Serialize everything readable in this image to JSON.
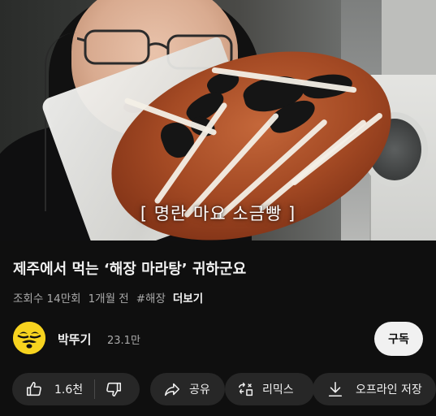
{
  "video": {
    "caption": "[ 명란 마요 소금빵 ]"
  },
  "info": {
    "title": "제주에서 먹는 ‘해장 마라탕’ 귀하군요",
    "views": "조회수 14만회",
    "age": "1개월 전",
    "hashtag": "#해장",
    "more_label": "더보기"
  },
  "channel": {
    "name": "박뚜기",
    "subscribers": "23.1만",
    "subscribe_label": "구독",
    "avatar_color": "#f7d31f"
  },
  "actions": {
    "like_count": "1.6천",
    "share_label": "공유",
    "remix_label": "리믹스",
    "download_label": "오프라인 저장"
  },
  "icons": {
    "like": "thumbs-up-icon",
    "dislike": "thumbs-down-icon",
    "share": "share-arrow-icon",
    "remix": "remix-icon",
    "download": "download-icon"
  },
  "colors": {
    "background": "#0f0f0f",
    "pill": "#272727",
    "text_primary": "#f1f1f1",
    "text_secondary": "#aaaaaa",
    "subscribe_bg": "#f1f1f1"
  }
}
